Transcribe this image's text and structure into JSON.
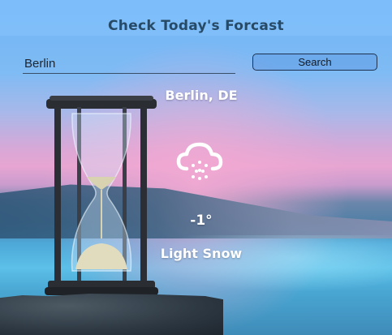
{
  "header": {
    "title": "Check Today's Forcast"
  },
  "search": {
    "value": "Berlin",
    "button_label": "Search"
  },
  "weather": {
    "location": "Berlin, DE",
    "temperature": "-1°",
    "condition": "Light Snow",
    "icon": "cloud-snow-icon"
  },
  "colors": {
    "title": "#274a66",
    "weather_text": "#ffffff",
    "accent": "#1f3350"
  }
}
